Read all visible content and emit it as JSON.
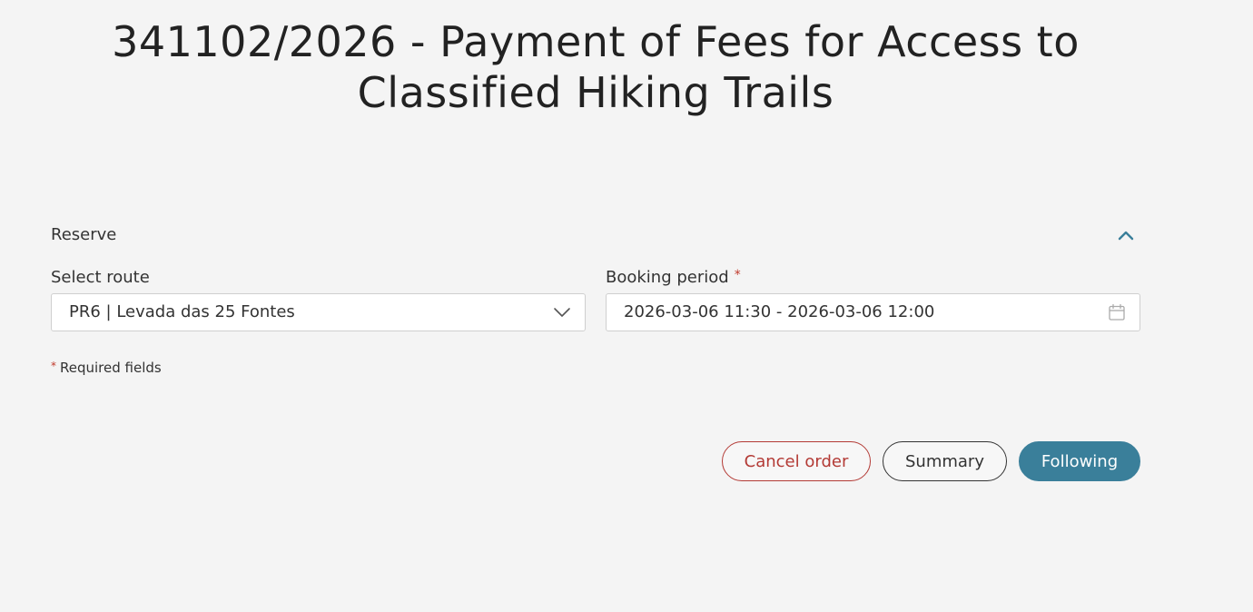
{
  "page": {
    "title": "341102/2026 - Payment of Fees for Access to Classified Hiking Trails"
  },
  "section": {
    "title": "Reserve",
    "toggle_icon": "chevron-up-icon"
  },
  "route_field": {
    "label": "Select route",
    "value": "PR6 | Levada das 25 Fontes",
    "icon": "chevron-down-icon"
  },
  "period_field": {
    "label": "Booking period",
    "required_mark": "*",
    "value": "2026-03-06 11:30 - 2026-03-06 12:00",
    "icon": "calendar-icon"
  },
  "required_note": {
    "mark": "*",
    "text": "Required fields"
  },
  "actions": {
    "cancel_label": "Cancel order",
    "summary_label": "Summary",
    "next_label": "Following"
  },
  "colors": {
    "background": "#f4f4f4",
    "accent": "#3a7f9a",
    "danger": "#b33a35",
    "required": "#c0392b"
  }
}
